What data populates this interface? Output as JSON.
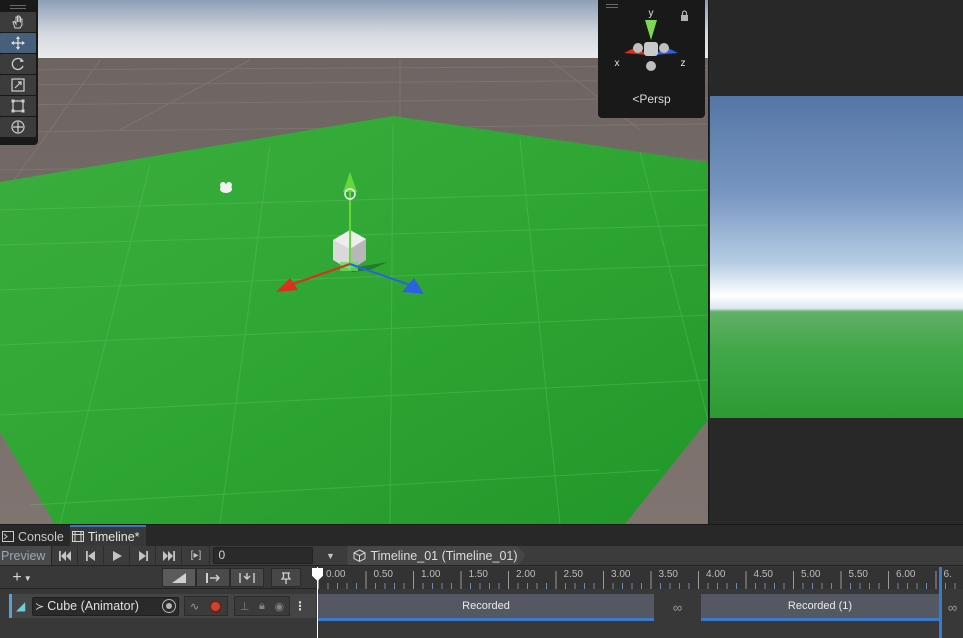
{
  "scene": {
    "gizmo": {
      "axis_y": "y",
      "axis_x": "x",
      "axis_z": "z",
      "projection_label": "Persp",
      "lock_icon": "lock-icon"
    },
    "tools": [
      {
        "name": "hand-tool",
        "icon": "hand-icon",
        "active": false
      },
      {
        "name": "move-tool",
        "icon": "move-icon",
        "active": true
      },
      {
        "name": "rotate-tool",
        "icon": "rotate-icon",
        "active": false
      },
      {
        "name": "scale-tool",
        "icon": "scale-icon",
        "active": false
      },
      {
        "name": "rect-tool",
        "icon": "rect-icon",
        "active": false
      },
      {
        "name": "transform-tool",
        "icon": "transform-icon",
        "active": false
      }
    ],
    "colors": {
      "ground": "#30a534",
      "sky_top": "#8aa0bd",
      "horizon": "#e6e8ec",
      "outer_floor": "#7a6f6b",
      "axis_x": "#d8311c",
      "axis_y": "#66d83d",
      "axis_z": "#2b62e0"
    }
  },
  "tabs": [
    {
      "label": "Console",
      "icon": "console-icon",
      "active": false
    },
    {
      "label": "Timeline*",
      "icon": "timeline-icon",
      "active": true
    }
  ],
  "toolbar": {
    "preview_label": "Preview",
    "frame_value": "0",
    "frame_range_glyph": "[▸]",
    "timeline_asset": "Timeline_01 (Timeline_01)"
  },
  "ruler": {
    "labels": [
      "0.00",
      "0.50",
      "1.00",
      "1.50",
      "2.00",
      "2.50",
      "3.00",
      "3.50",
      "4.00",
      "4.50",
      "5.00",
      "5.50",
      "6.00",
      "6."
    ]
  },
  "track": {
    "binding_label": "Cube (Animator)",
    "clips": [
      {
        "label": "Recorded"
      },
      {
        "label": "Recorded (1)"
      }
    ],
    "blend_glyph": "∞"
  }
}
